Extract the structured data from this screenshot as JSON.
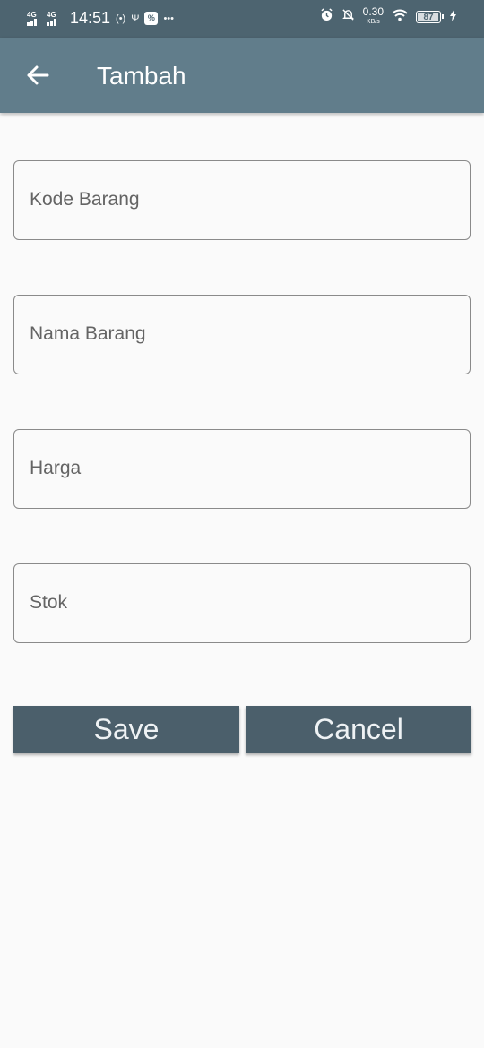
{
  "status_bar": {
    "network_1": "4G",
    "network_2": "4G",
    "time": "14:51",
    "hotspot_icon": "(•)",
    "usb_icon": "Ψ",
    "app_icon": "%",
    "more_icon": "•••",
    "alarm_icon": "alarm-clock",
    "mute_icon": "bell-off",
    "speed_value": "0.30",
    "speed_unit": "KB/s",
    "battery_level": "87",
    "charging_icon": "lightning-bolt"
  },
  "app_bar": {
    "title": "Tambah",
    "back_icon": "arrow-left",
    "background": "#617d8b"
  },
  "form": {
    "fields": [
      {
        "placeholder": "Kode Barang",
        "value": ""
      },
      {
        "placeholder": "Nama Barang",
        "value": ""
      },
      {
        "placeholder": "Harga",
        "value": ""
      },
      {
        "placeholder": "Stok",
        "value": ""
      }
    ]
  },
  "buttons": {
    "save_label": "Save",
    "cancel_label": "Cancel",
    "color": "#4b5f6b"
  }
}
